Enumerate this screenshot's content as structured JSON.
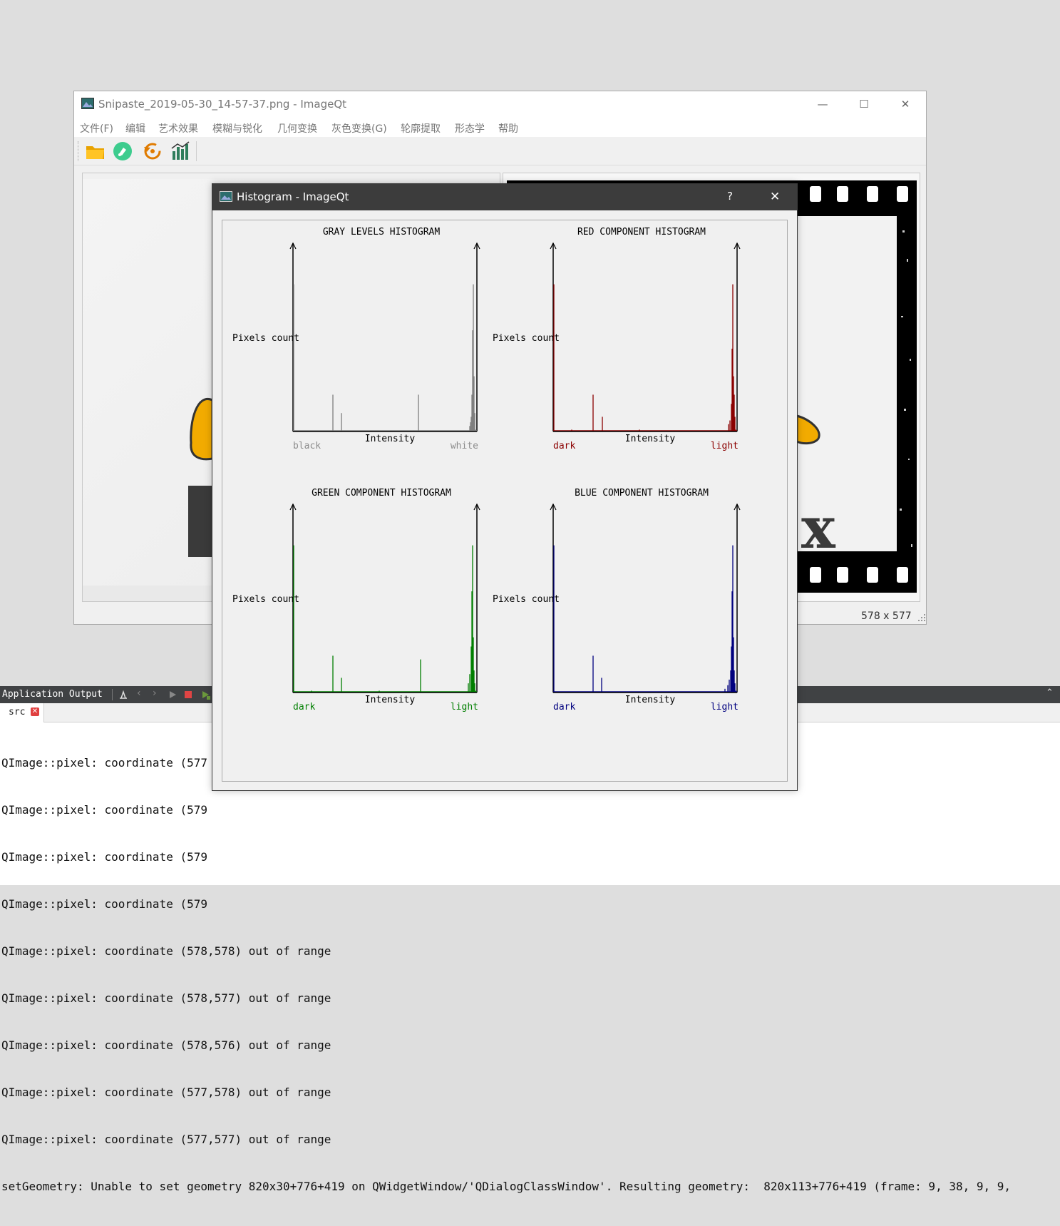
{
  "main_window": {
    "title": "Snipaste_2019-05-30_14-57-37.png - ImageQt",
    "controls": {
      "minimize": "—",
      "maximize": "☐",
      "close": "✕"
    },
    "menu": [
      "文件(F)",
      "编辑",
      "艺术效果",
      "模糊与锐化",
      "几何变换",
      "灰色变换(G)",
      "轮廓提取",
      "形态学",
      "帮助"
    ],
    "toolbar": [
      {
        "icon": "folder-open-icon"
      },
      {
        "icon": "brush-icon"
      },
      {
        "icon": "restore-icon"
      },
      {
        "icon": "histogram-icon"
      }
    ],
    "status": {
      "size": "578 x 577"
    }
  },
  "histogram_dialog": {
    "title": "Histogram - ImageQt",
    "controls": {
      "help": "?",
      "close": "✕"
    },
    "charts": [
      {
        "id": "gray",
        "title": "GRAY LEVELS HISTOGRAM",
        "ylabel": "Pixels count",
        "xlabel": "Intensity",
        "left_label": "black",
        "right_label": "white",
        "color": "#7f7f7f",
        "label_color": "#8c8c8c"
      },
      {
        "id": "red",
        "title": "RED COMPONENT HISTOGRAM",
        "ylabel": "Pixels count",
        "xlabel": "Intensity",
        "left_label": "dark",
        "right_label": "light",
        "color": "#8b0000",
        "label_color": "#8b0000"
      },
      {
        "id": "green",
        "title": "GREEN COMPONENT HISTOGRAM",
        "ylabel": "Pixels count",
        "xlabel": "Intensity",
        "left_label": "dark",
        "right_label": "light",
        "color": "#007f00",
        "label_color": "#007f00"
      },
      {
        "id": "blue",
        "title": "BLUE COMPONENT HISTOGRAM",
        "ylabel": "Pixels count",
        "xlabel": "Intensity",
        "left_label": "dark",
        "right_label": "light",
        "color": "#00007f",
        "label_color": "#00007f"
      }
    ]
  },
  "chart_data": [
    {
      "type": "bar",
      "title": "GRAY LEVELS HISTOGRAM",
      "xlabel": "Intensity",
      "ylabel": "Pixels count",
      "xlim": [
        0,
        255
      ],
      "series": [
        {
          "values": [
            [
              0,
              0.8
            ],
            [
              55,
              0.2
            ],
            [
              67,
              0.1
            ],
            [
              175,
              0.2
            ],
            [
              247,
              0.03
            ],
            [
              248,
              0.05
            ],
            [
              249,
              0.08
            ],
            [
              250,
              0.2
            ],
            [
              251,
              0.55
            ],
            [
              252,
              0.8
            ],
            [
              253,
              0.3
            ],
            [
              254,
              0.1
            ],
            [
              255,
              0.01
            ]
          ]
        }
      ]
    },
    {
      "type": "bar",
      "title": "RED COMPONENT HISTOGRAM",
      "xlabel": "Intensity",
      "ylabel": "Pixels count",
      "xlim": [
        0,
        255
      ],
      "series": [
        {
          "values": [
            [
              0,
              0.8
            ],
            [
              25,
              0.01
            ],
            [
              55,
              0.2
            ],
            [
              68,
              0.08
            ],
            [
              120,
              0.01
            ],
            [
              245,
              0.04
            ],
            [
              247,
              0.06
            ],
            [
              249,
              0.15
            ],
            [
              250,
              0.45
            ],
            [
              251,
              0.8
            ],
            [
              252,
              0.3
            ],
            [
              253,
              0.2
            ],
            [
              254,
              0.08
            ],
            [
              255,
              0.01
            ]
          ]
        }
      ]
    },
    {
      "type": "bar",
      "title": "GREEN COMPONENT HISTOGRAM",
      "xlabel": "Intensity",
      "ylabel": "Pixels count",
      "xlim": [
        0,
        255
      ],
      "series": [
        {
          "values": [
            [
              0,
              0.8
            ],
            [
              25,
              0.01
            ],
            [
              55,
              0.2
            ],
            [
              67,
              0.08
            ],
            [
              120,
              0.01
            ],
            [
              178,
              0.18
            ],
            [
              245,
              0.05
            ],
            [
              247,
              0.1
            ],
            [
              249,
              0.25
            ],
            [
              250,
              0.55
            ],
            [
              251,
              0.8
            ],
            [
              252,
              0.3
            ],
            [
              253,
              0.12
            ],
            [
              254,
              0.05
            ],
            [
              255,
              0.01
            ]
          ]
        }
      ]
    },
    {
      "type": "bar",
      "title": "BLUE COMPONENT HISTOGRAM",
      "xlabel": "Intensity",
      "ylabel": "Pixels count",
      "xlim": [
        0,
        255
      ],
      "series": [
        {
          "values": [
            [
              0,
              0.8
            ],
            [
              55,
              0.2
            ],
            [
              67,
              0.08
            ],
            [
              240,
              0.02
            ],
            [
              244,
              0.04
            ],
            [
              246,
              0.07
            ],
            [
              248,
              0.12
            ],
            [
              249,
              0.25
            ],
            [
              250,
              0.55
            ],
            [
              251,
              0.8
            ],
            [
              252,
              0.3
            ],
            [
              253,
              0.12
            ],
            [
              254,
              0.05
            ],
            [
              255,
              0.01
            ]
          ]
        }
      ]
    }
  ],
  "output_pane": {
    "title": "Application Output",
    "tab": "src",
    "lines": [
      "QImage::pixel: coordinate (577",
      "QImage::pixel: coordinate (579",
      "QImage::pixel: coordinate (579",
      "QImage::pixel: coordinate (579",
      "QImage::pixel: coordinate (578,578) out of range",
      "QImage::pixel: coordinate (578,577) out of range",
      "QImage::pixel: coordinate (578,576) out of range",
      "QImage::pixel: coordinate (577,578) out of range",
      "QImage::pixel: coordinate (577,577) out of range",
      "setGeometry: Unable to set geometry 820x30+776+419 on QWidgetWindow/'QDialogClassWindow'. Resulting geometry:  820x113+776+419 (frame: 9, 38, 9, 9,"
    ]
  }
}
